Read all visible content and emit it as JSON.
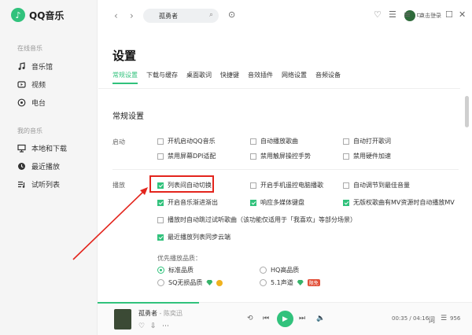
{
  "app": {
    "name": "QQ音乐"
  },
  "sidebar": {
    "online_section": "在线音乐",
    "online_items": [
      {
        "label": "音乐馆",
        "icon": "music-note-icon"
      },
      {
        "label": "视频",
        "icon": "video-icon"
      },
      {
        "label": "电台",
        "icon": "radio-icon"
      }
    ],
    "my_section": "我的音乐",
    "my_items": [
      {
        "label": "本地和下载",
        "icon": "computer-icon"
      },
      {
        "label": "最近播放",
        "icon": "clock-icon"
      },
      {
        "label": "试听列表",
        "icon": "playlist-icon"
      }
    ]
  },
  "topbar": {
    "search_value": "孤勇者",
    "login_label": "点击登录"
  },
  "settings": {
    "title": "设置",
    "tabs": [
      "常规设置",
      "下载与缓存",
      "桌面歌词",
      "快捷键",
      "音效插件",
      "网络设置",
      "音频设备"
    ],
    "section_title": "常规设置",
    "startup": {
      "label": "启动",
      "options": [
        {
          "label": "开机启动QQ音乐",
          "checked": false
        },
        {
          "label": "自动播放歌曲",
          "checked": false
        },
        {
          "label": "自动打开歌词",
          "checked": false
        },
        {
          "label": "禁用屏幕DPI适配",
          "checked": false
        },
        {
          "label": "禁用触屏操控手势",
          "checked": false
        },
        {
          "label": "禁用硬件加速",
          "checked": false
        }
      ]
    },
    "playback": {
      "label": "播放",
      "options": [
        {
          "label": "列表间自动切换",
          "checked": true
        },
        {
          "label": "开启手机遥控电脑播歌",
          "checked": false
        },
        {
          "label": "自动调节到最佳音量",
          "checked": false
        },
        {
          "label": "开启音乐渐进渐出",
          "checked": true
        },
        {
          "label": "响应多媒体键盘",
          "checked": true
        },
        {
          "label": "无版权歌曲有MV资源时自动播放MV",
          "checked": true
        },
        {
          "label": "播放时自动跳过试听歌曲（该功能仅适用于「我喜欢」等部分场景）",
          "checked": false
        },
        {
          "label": "最近播放列表同步云端",
          "checked": true
        }
      ],
      "quality_label": "优先播放品质：",
      "quality_options": [
        {
          "label": "标准品质",
          "selected": true
        },
        {
          "label": "HQ高品质",
          "selected": false
        },
        {
          "label": "SQ无损品质",
          "selected": false
        },
        {
          "label": "5.1声道",
          "selected": false
        }
      ],
      "badge_text": "限免"
    }
  },
  "player": {
    "song": "孤勇者",
    "artist": "陈奕迅",
    "time": "00:35 / 04:16",
    "count": "956",
    "progress": 0.27
  },
  "accent": "#31c27c",
  "annotation_color": "#e3251d"
}
